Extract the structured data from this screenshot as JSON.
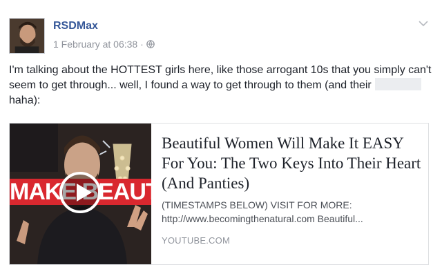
{
  "post": {
    "author": "RSDMax",
    "timestamp": "1 February at 06:38 ·",
    "privacy_icon": "globe-icon",
    "menu_icon": "chevron-down-icon",
    "text_before_redaction": "I'm talking about the HOTTEST girls here, like those arrogant 10s that you simply can't seem to get through... well, I found a way to get through to them (and their",
    "text_after_redaction": "haha):"
  },
  "link_card": {
    "title": "Beautiful Women Will Make It EASY For You: The Two Keys Into Their Heart (And Panties)",
    "description_line1": "(TIMESTAMPS BELOW) VISIT FOR MORE:",
    "description_line2": "http://www.becomingthenatural.com Beautiful...",
    "domain": "YOUTUBE.COM",
    "thumbnail_caption": "MAKE BEAUTIFUL",
    "play_icon": "play-icon",
    "accent_color": "#d9282f"
  },
  "colors": {
    "author_link": "#365899",
    "meta_text": "#90949c",
    "body_text": "#1d2129"
  }
}
